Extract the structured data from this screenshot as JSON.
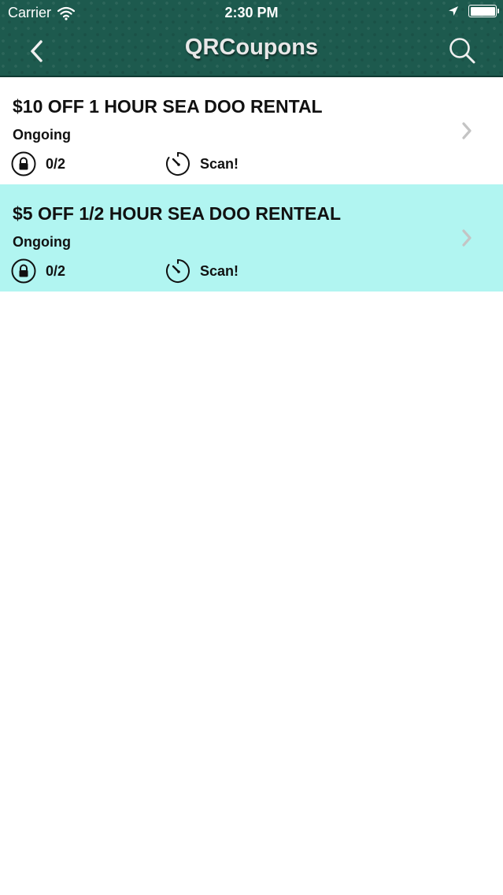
{
  "status_bar": {
    "carrier": "Carrier",
    "time": "2:30 PM"
  },
  "nav": {
    "title": "QRCoupons"
  },
  "colors": {
    "header_bg": "#1d5a4e",
    "highlight_row": "#b1f5f1",
    "text": "#111111"
  },
  "coupons": [
    {
      "title": "$10 OFF 1 HOUR SEA DOO RENTAL",
      "status": "Ongoing",
      "redeemed": "0/2",
      "action": "Scan!"
    },
    {
      "title": "$5 OFF 1/2 HOUR SEA DOO RENTEAL",
      "status": "Ongoing",
      "redeemed": "0/2",
      "action": "Scan!"
    }
  ]
}
